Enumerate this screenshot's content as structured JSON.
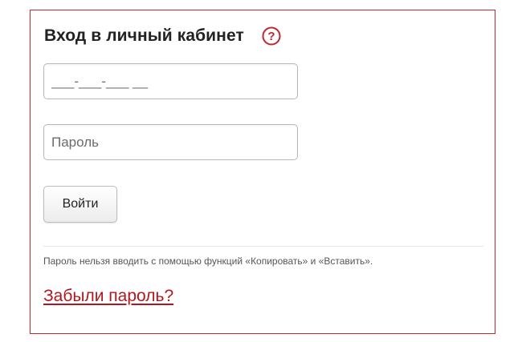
{
  "login": {
    "title": "Вход в личный кабинет",
    "help_icon": "question-circle-icon",
    "phone_placeholder": "___-___-___ __",
    "password_placeholder": "Пароль",
    "submit_label": "Войти",
    "note": "Пароль нельзя вводить с помощью функций «Копировать» и «Вставить».",
    "forgot_link": "Забыли пароль?"
  },
  "colors": {
    "accent": "#c0272d",
    "link": "#b3171d"
  }
}
